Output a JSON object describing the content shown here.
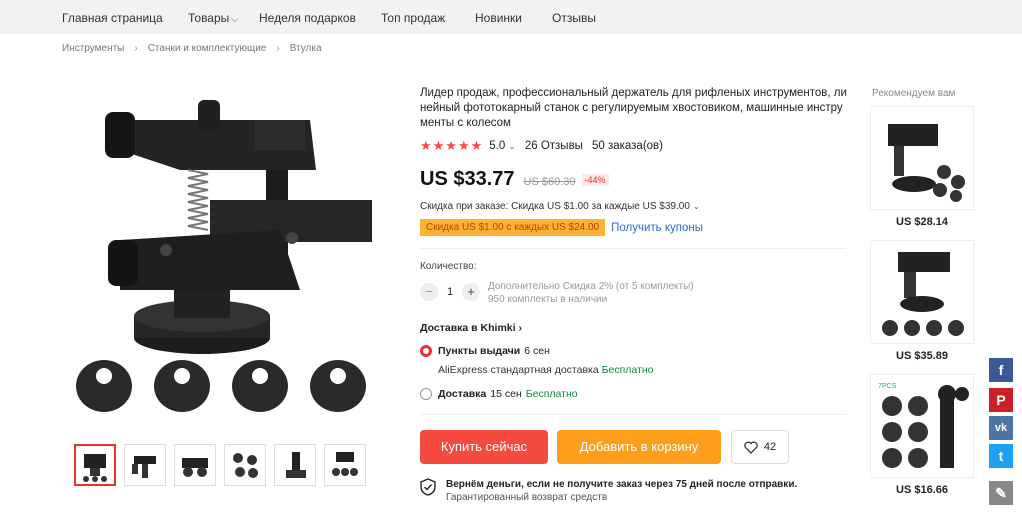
{
  "nav": {
    "items": [
      "Главная страница",
      "Товары",
      "Неделя подарков",
      "Топ продаж",
      "Новинки",
      "Отзывы"
    ]
  },
  "breadcrumb": [
    "Инструменты",
    "Станки и комплектующие",
    "Втулка"
  ],
  "product": {
    "title": "Лидер продаж, профессиональный держатель для рифленых инструментов, ли нейный фототокарный станок с регулируемым хвостовиком, машинные инстру менты с колесом",
    "rating": "5.0",
    "reviews": "26 Отзывы",
    "orders": "50 заказа(ов)",
    "price": "US $33.77",
    "old_price": "US $60.30",
    "discount": "-44%",
    "order_discount": "Скидка при заказе: Скидка US $1.00 за каждые US $39.00",
    "coupon_badge": "Скидка US $1.00 с каждых US $24.00",
    "coupon_link": "Получить купоны",
    "qty_label": "Количество:",
    "qty_value": "1",
    "qty_note_1": "Дополнительно Скидка 2% (от 5 комплекты)",
    "qty_note_2": "950 комплекты в наличии",
    "delivery_head": "Доставка в Khimki",
    "pickup_label": "Пункты выдачи",
    "pickup_days": "6 сен",
    "pickup_carrier": "AliExpress стандартная доставка",
    "free": "Бесплатно",
    "courier_label": "Доставка",
    "courier_days": "15 сен",
    "buy_now": "Купить сейчас",
    "add_to_cart": "Добавить в корзину",
    "wish_count": "42",
    "guarantee_main": "Вернём деньги, если не получите заказ через 75 дней после отправки.",
    "guarantee_sub": "Гарантированный возврат средств"
  },
  "recommend": {
    "title": "Рекомендуем вам",
    "items": [
      {
        "price": "US $28.14"
      },
      {
        "price": "US $35.89"
      },
      {
        "price": "US $16.66",
        "badge": "7PCS"
      }
    ]
  },
  "colors": {
    "accent": "#f44a3f",
    "cart": "#ff9e1b",
    "coupon": "#ffb233",
    "link": "#2f6bd3",
    "free": "#138a36"
  },
  "icons": [
    "chevron-down-icon",
    "star-icon",
    "heart-icon",
    "shield-check-icon",
    "facebook-icon",
    "pinterest-icon",
    "vk-icon",
    "twitter-icon",
    "pencil-icon"
  ]
}
